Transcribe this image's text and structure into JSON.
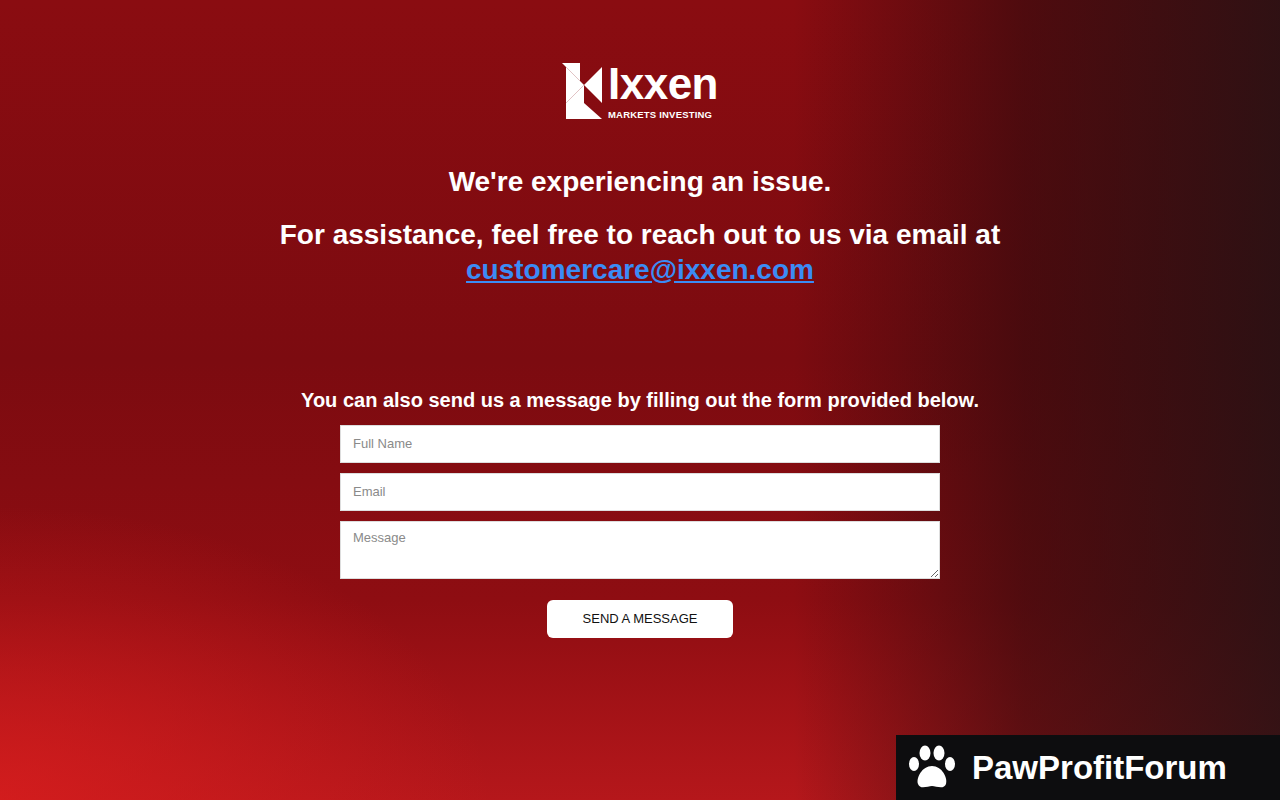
{
  "logo": {
    "name": "Ixxen",
    "tagline": "MARKETS INVESTING"
  },
  "heading": "We're experiencing an issue.",
  "assistance": {
    "text": "For assistance, feel free to reach out to us via email at",
    "email": "customercare@ixxen.com"
  },
  "form": {
    "intro": "You can also send us a message by filling out the form provided below.",
    "fields": [
      {
        "placeholder": "Full Name",
        "kind": "input"
      },
      {
        "placeholder": "Email",
        "kind": "input"
      },
      {
        "placeholder": "Message",
        "kind": "textarea"
      }
    ],
    "button": "SEND A MESSAGE"
  },
  "watermark": {
    "text": "PawProfitForum"
  }
}
